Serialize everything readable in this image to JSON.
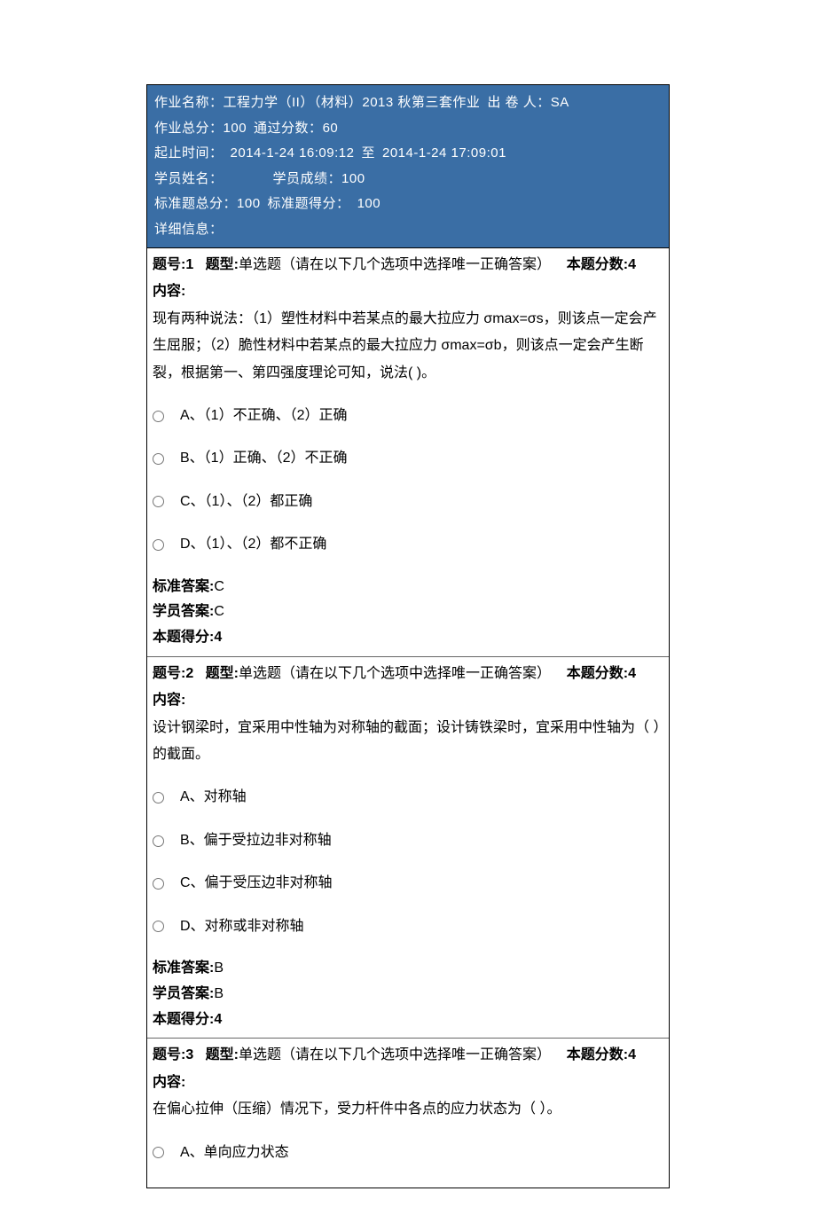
{
  "header": {
    "labels": {
      "assignmentName": "作业名称：",
      "setter": "出 卷 人：",
      "totalScore": "作业总分：",
      "passScore": "通过分数：",
      "period": "起止时间：",
      "to": "至",
      "studentName": "学员姓名：",
      "studentScore": "学员成绩：",
      "stdTotal": "标准题总分：",
      "stdGot": "标准题得分：",
      "details": "详细信息："
    },
    "values": {
      "assignmentName": "工程力学（II）（材料）2013 秋第三套作业",
      "setter": "SA",
      "totalScore": "100",
      "passScore": "60",
      "periodStart": "2014-1-24 16:09:12",
      "periodEnd": "2014-1-24 17:09:01",
      "studentName": "",
      "studentScore": "100",
      "stdTotal": "100",
      "stdGot": "100"
    }
  },
  "questionLabels": {
    "no": "题号:",
    "type": "题型:",
    "typeDesc": "单选题（请在以下几个选项中选择唯一正确答案）",
    "points": "本题分数:",
    "content": "内容:",
    "stdAnswer": "标准答案:",
    "stuAnswer": "学员答案:",
    "got": "本题得分:"
  },
  "questions": [
    {
      "no": "1",
      "points": "4",
      "content": "现有两种说法：（1）塑性材料中若某点的最大拉应力 σmax=σs，则该点一定会产生屈服；（2）脆性材料中若某点的最大拉应力 σmax=σb，则该点一定会产生断裂，根据第一、第四强度理论可知，说法( )。",
      "options": [
        "A、（1）不正确、（2）正确",
        "B、（1）正确、（2）不正确",
        "C、（1）、（2）都正确",
        "D、（1）、（2）都不正确"
      ],
      "stdAnswer": "C",
      "stuAnswer": "C",
      "got": "4"
    },
    {
      "no": "2",
      "points": "4",
      "content": "设计钢梁时，宜采用中性轴为对称轴的截面；设计铸铁梁时，宜采用中性轴为（ ）的截面。",
      "options": [
        "A、对称轴",
        "B、偏于受拉边非对称轴",
        "C、偏于受压边非对称轴",
        "D、对称或非对称轴"
      ],
      "stdAnswer": "B",
      "stuAnswer": "B",
      "got": "4"
    },
    {
      "no": "3",
      "points": "4",
      "content": "在偏心拉伸（压缩）情况下，受力杆件中各点的应力状态为（ ）。",
      "options": [
        "A、单向应力状态"
      ],
      "stdAnswer": "",
      "stuAnswer": "",
      "got": ""
    }
  ]
}
